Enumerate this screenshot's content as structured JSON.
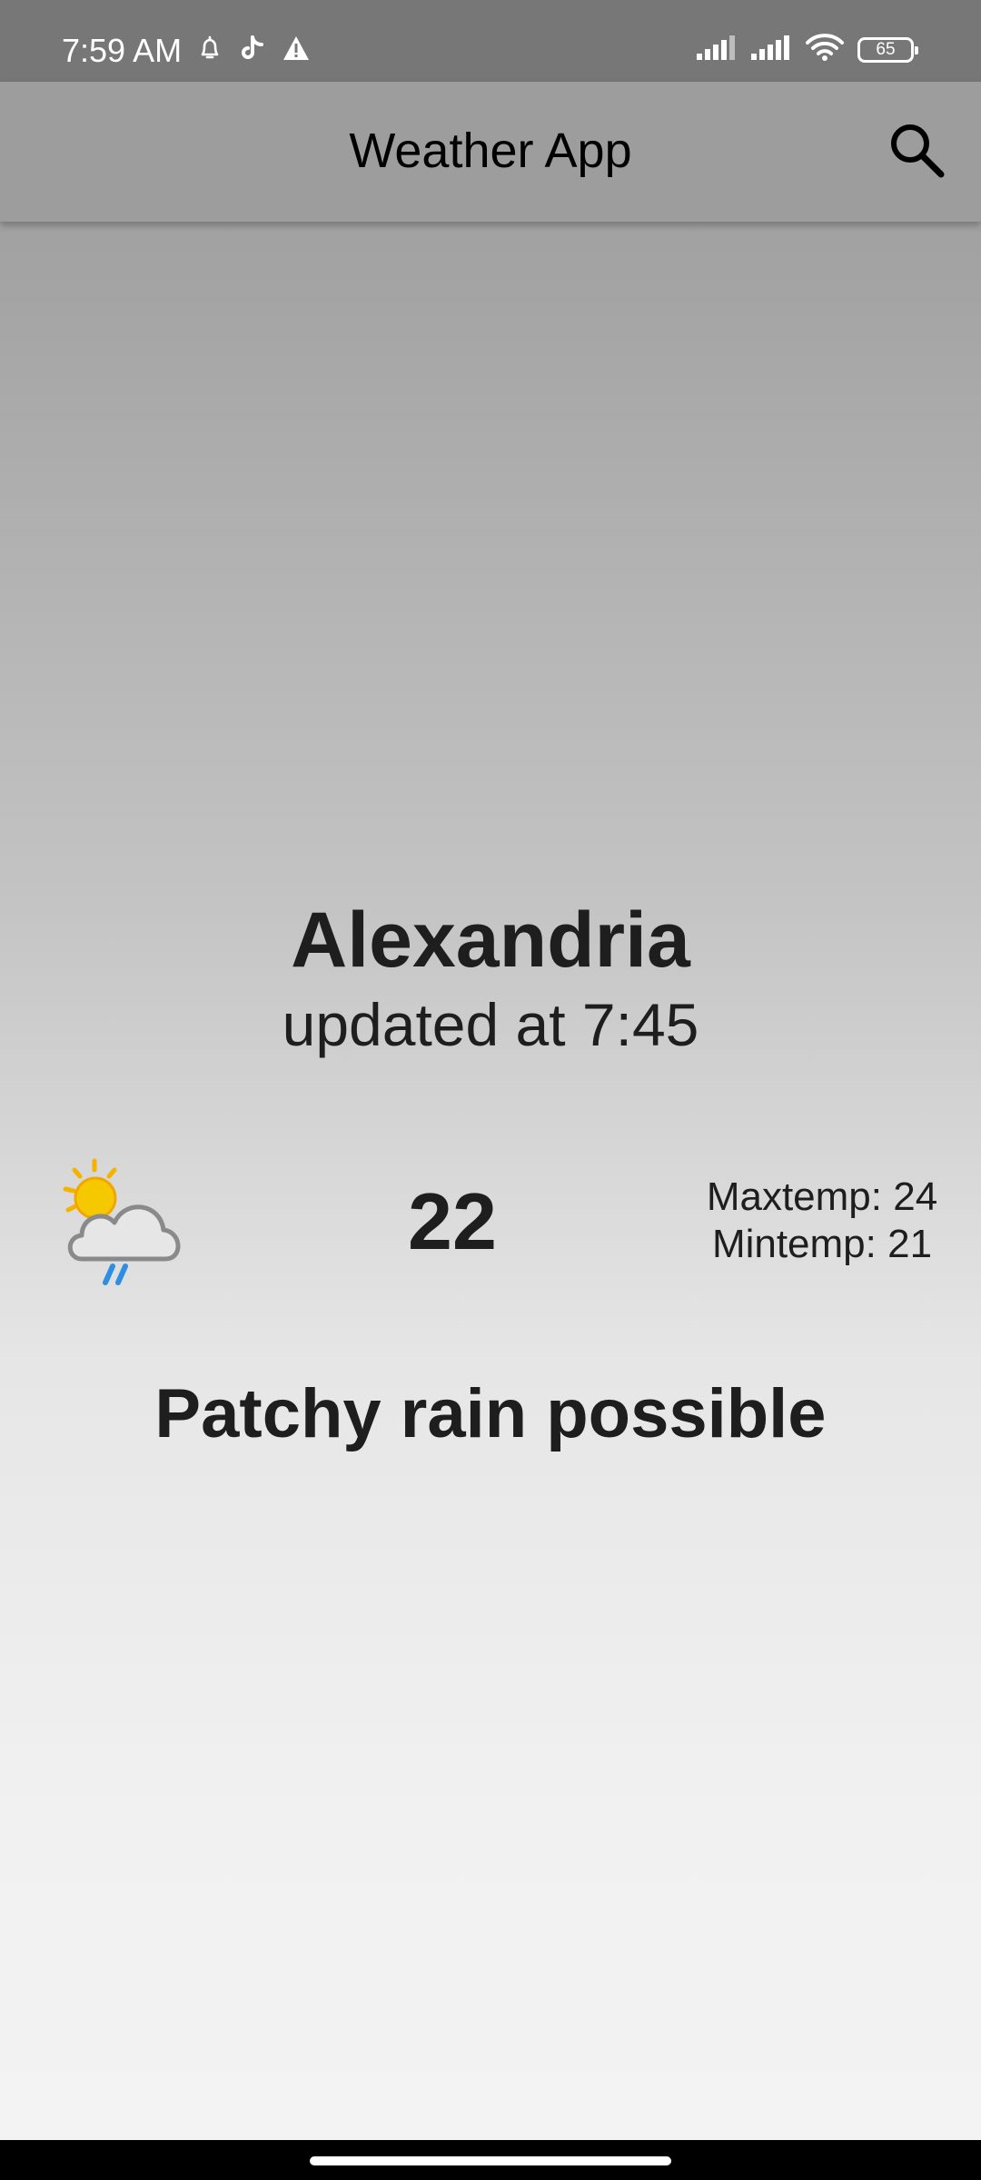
{
  "status_bar": {
    "time": "7:59 AM",
    "battery": "65",
    "icons": [
      "alarm-icon",
      "tiktok-icon",
      "warning-icon",
      "signal-icon",
      "signal-icon",
      "wifi-icon",
      "battery-icon"
    ]
  },
  "app_bar": {
    "title": "Weather App",
    "search_icon": "search-icon"
  },
  "weather": {
    "city": "Alexandria",
    "updated": "updated at 7:45",
    "icon": "partly-cloudy-rain-icon",
    "temperature": "22",
    "max_temp": "Maxtemp: 24",
    "min_temp": "Mintemp: 21",
    "condition": "Patchy rain possible"
  },
  "colors": {
    "status_bar": "#777777",
    "app_bar": "#9d9d9d",
    "text": "#1e1e1e",
    "sun": "#f5c800",
    "rain": "#2e8fe0"
  }
}
